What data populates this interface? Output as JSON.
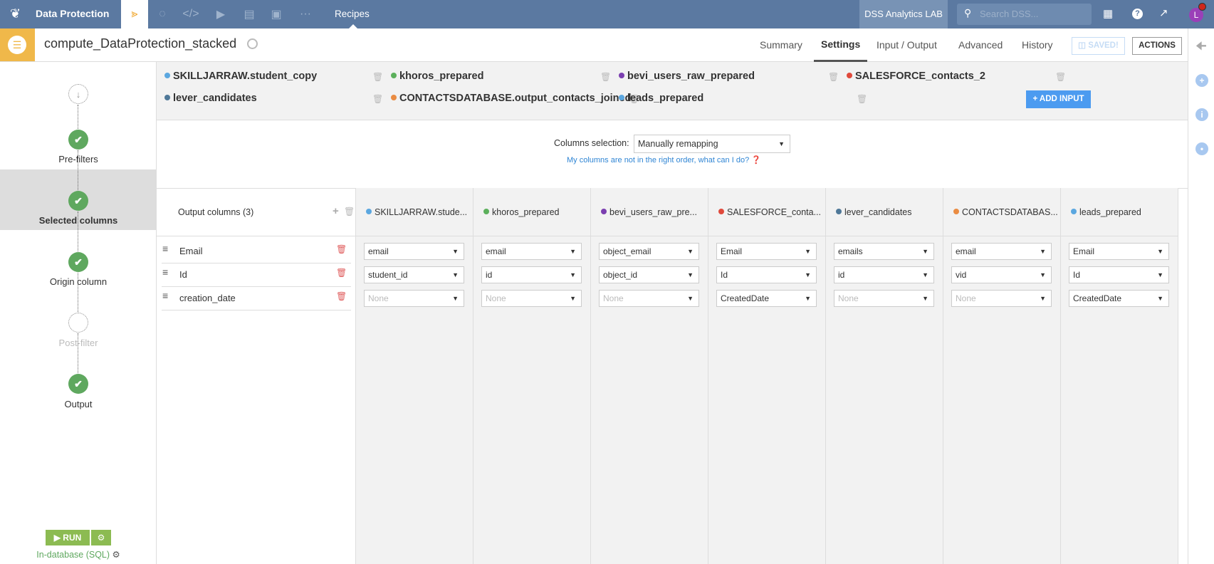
{
  "topnav": {
    "project": "Data Protection",
    "section": "Recipes",
    "instance": "DSS Analytics LAB",
    "search_placeholder": "Search DSS...",
    "avatar_letter": "L"
  },
  "header": {
    "title": "compute_DataProtection_stacked",
    "tabs": [
      "Summary",
      "Settings",
      "Input / Output",
      "Advanced",
      "History"
    ],
    "active_tab": "Settings",
    "saved_label": "SAVED!",
    "actions_label": "ACTIONS"
  },
  "steps": [
    {
      "label": "",
      "state": "start"
    },
    {
      "label": "Pre-filters",
      "state": "ok"
    },
    {
      "label": "Selected columns",
      "state": "ok",
      "selected": true
    },
    {
      "label": "Origin column",
      "state": "ok"
    },
    {
      "label": "Post-filter",
      "state": "empty"
    },
    {
      "label": "Output",
      "state": "ok"
    }
  ],
  "run": {
    "label": "RUN",
    "engine": "In-database (SQL)"
  },
  "inputs": [
    {
      "name": "SKILLJARRAW.student_copy",
      "color": "#5ba7e0"
    },
    {
      "name": "khoros_prepared",
      "color": "#5cb05c"
    },
    {
      "name": "bevi_users_raw_prepared",
      "color": "#7b3fb0"
    },
    {
      "name": "SALESFORCE_contacts_2",
      "color": "#e04a3c"
    },
    {
      "name": "lever_candidates",
      "color": "#4f7898"
    },
    {
      "name": "CONTACTSDATABASE.output_contacts_joined",
      "color": "#ea8c43"
    },
    {
      "name": "leads_prepared",
      "color": "#5ba7e0"
    }
  ],
  "add_input_label": "+ ADD INPUT",
  "columns_selection": {
    "label": "Columns selection:",
    "value": "Manually remapping",
    "help_link": "My columns are not in the right order, what can I do?"
  },
  "output_columns": {
    "header": "Output columns (3)",
    "rows": [
      "Email",
      "Id",
      "creation_date"
    ]
  },
  "mapping_headers": [
    "SKILLJARRAW.stude...",
    "khoros_prepared",
    "bevi_users_raw_pre...",
    "SALESFORCE_conta...",
    "lever_candidates",
    "CONTACTSDATABAS...",
    "leads_prepared"
  ],
  "mapping": [
    [
      "email",
      "student_id",
      "None"
    ],
    [
      "email",
      "id",
      "None"
    ],
    [
      "object_email",
      "object_id",
      "None"
    ],
    [
      "Email",
      "Id",
      "CreatedDate"
    ],
    [
      "emails",
      "id",
      "None"
    ],
    [
      "email",
      "vid",
      "None"
    ],
    [
      "Email",
      "Id",
      "CreatedDate"
    ]
  ]
}
